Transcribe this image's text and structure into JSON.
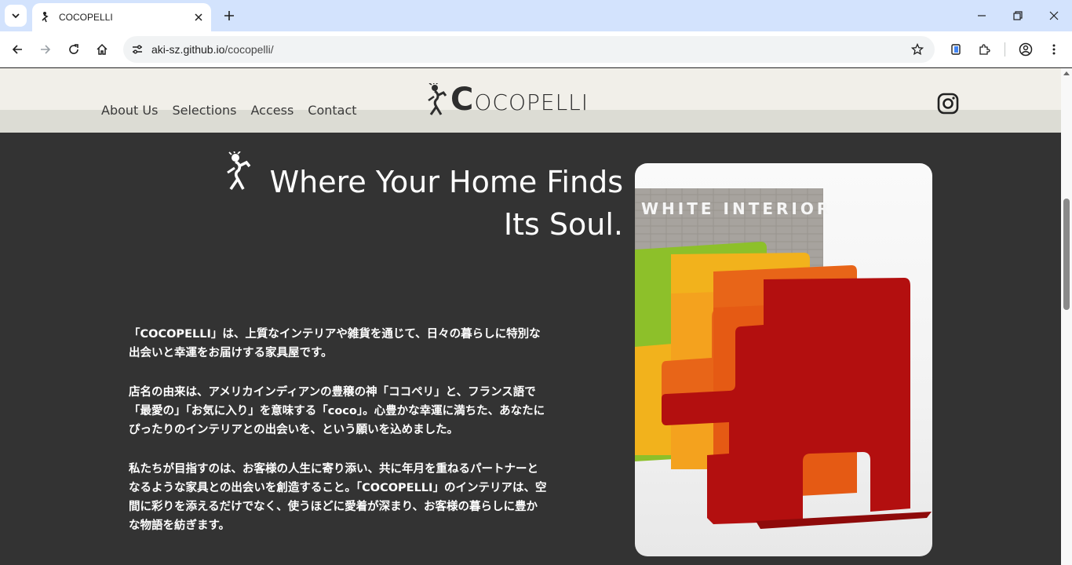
{
  "browser": {
    "tab_title": "COCOPELLI",
    "url_host": "aki-sz.github.io",
    "url_path": "/cocopelli/"
  },
  "site": {
    "nav": [
      "About Us",
      "Selections",
      "Access",
      "Contact"
    ],
    "logo_text_initial": "C",
    "logo_text_rest": "OCOPELLI",
    "hero_title_line1": "Where Your Home Finds",
    "hero_title_line2": "Its Soul.",
    "paragraphs": [
      "「COCOPELLI」は、上質なインテリアや雑貨を通じて、日々の暮らしに特別な出会いと幸運をお届けする家具屋です。",
      "店名の由来は、アメリカインディアンの豊穣の神「ココペリ」と、フランス語で「最愛の」「お気に入り」を意味する「coco」。心豊かな幸運に満ちた、あなたにぴったりのインテリアとの出会いを、という願いを込めました。",
      "私たちが目指すのは、お客様の人生に寄り添い、共に年月を重ねるパートナーとなるような家具との出会いを創造すること。「COCOPELLI」のインテリアは、空間に彩りを添えるだけでなく、使うほどに愛着が深まり、お客様の暮らしに豊かな物語を紡ぎます。"
    ],
    "photo_caption": "WHITE INTERIOR"
  },
  "colors": {
    "page_bg": "#333333",
    "header_bg": "#f1efe9",
    "tabbar_bg": "#d3e3fd"
  }
}
